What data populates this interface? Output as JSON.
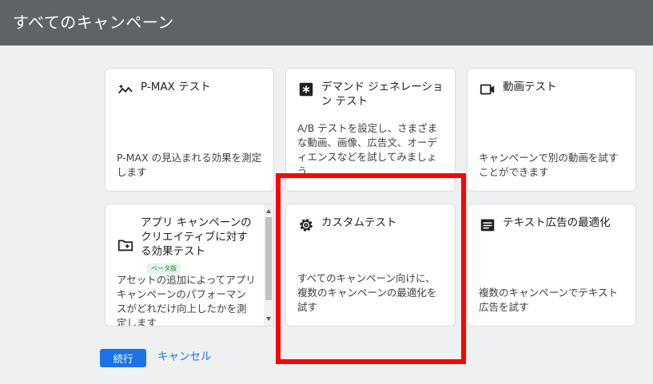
{
  "header": {
    "title": "すべてのキャンペーン"
  },
  "cards": [
    {
      "id": "pmax",
      "title": "P-MAX テスト",
      "icon": "trending-sparkle-icon",
      "description": "P-MAX の見込まれる効果を測定します"
    },
    {
      "id": "demand-gen",
      "title": "デマンド ジェネレーション テスト",
      "icon": "asterisk-box-icon",
      "description": "A/B テストを設定し、さまざまな動画、画像、広告文、オーディエンスなどを試してみましょう"
    },
    {
      "id": "video",
      "title": "動画テスト",
      "icon": "video-camera-icon",
      "description": "キャンペーンで別の動画を試すことができます"
    },
    {
      "id": "app",
      "title": "アプリ キャンペーンのクリエイティブに対する効果テスト",
      "icon": "folder-add-icon",
      "badge": "ベータ版",
      "description": "アセットの追加によってアプリ キャンペーンのパフォーマンスがどれだけ向上したかを測定します"
    },
    {
      "id": "custom",
      "title": "カスタムテスト",
      "icon": "gear-icon",
      "description": "すべてのキャンペーン向けに、複数のキャンペーンの最適化を試す"
    },
    {
      "id": "text-ad",
      "title": "テキスト広告の最適化",
      "icon": "text-ad-icon",
      "description": "複数のキャンペーンでテキスト広告を試す"
    }
  ],
  "actions": {
    "continue_label": "続行",
    "cancel_label": "キャンセル"
  },
  "colors": {
    "header_bg": "#5f6368",
    "primary": "#1a73e8",
    "highlight": "#ff0000"
  }
}
